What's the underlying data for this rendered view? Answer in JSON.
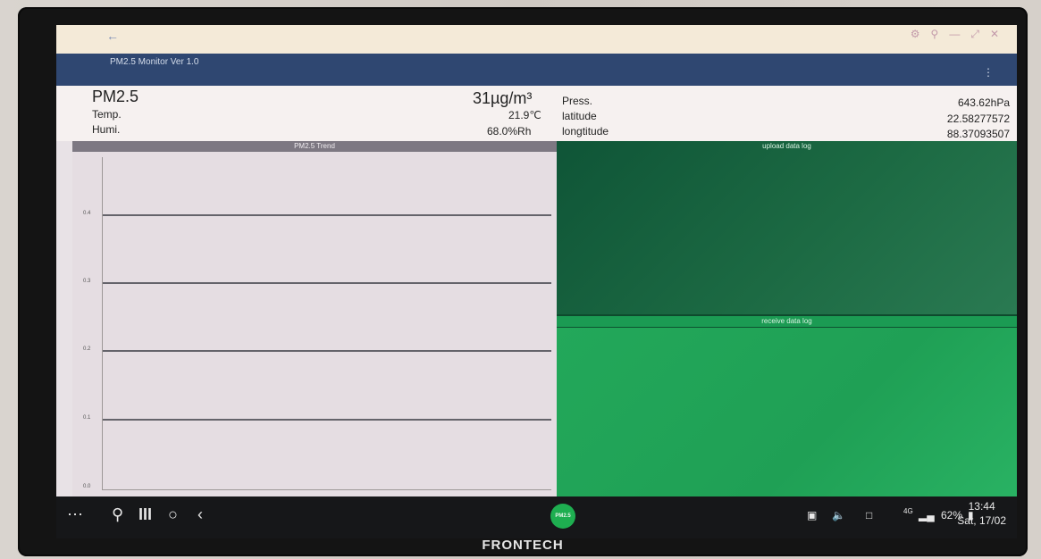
{
  "window": {
    "title": "PM2.5 Monitor Ver 1.0"
  },
  "readings": {
    "pm25_label": "PM2.5",
    "pm25_value": "31µg/m³",
    "temp_label": "Temp.",
    "temp_value": "21.9℃",
    "humi_label": "Humi.",
    "humi_value": "68.0%Rh",
    "press_label": "Press.",
    "press_value": "643.62hPa",
    "lat_label": "latitude",
    "lat_value": "22.58277572",
    "lon_label": "longtitude",
    "lon_value": "88.37093507"
  },
  "trend": {
    "title": "PM2.5 Trend",
    "y_ticks": [
      "0.4",
      "0.3",
      "0.2",
      "0.1",
      "0.0"
    ]
  },
  "logs": {
    "upload_title": "upload data log",
    "receive_title": "receive data log"
  },
  "taskbar": {
    "app_badge": "PM2.5",
    "network": "4G",
    "battery": "62%",
    "time": "13:44",
    "date": "Sat, 17/02"
  },
  "bezel": {
    "brand": "FRONTECH"
  }
}
